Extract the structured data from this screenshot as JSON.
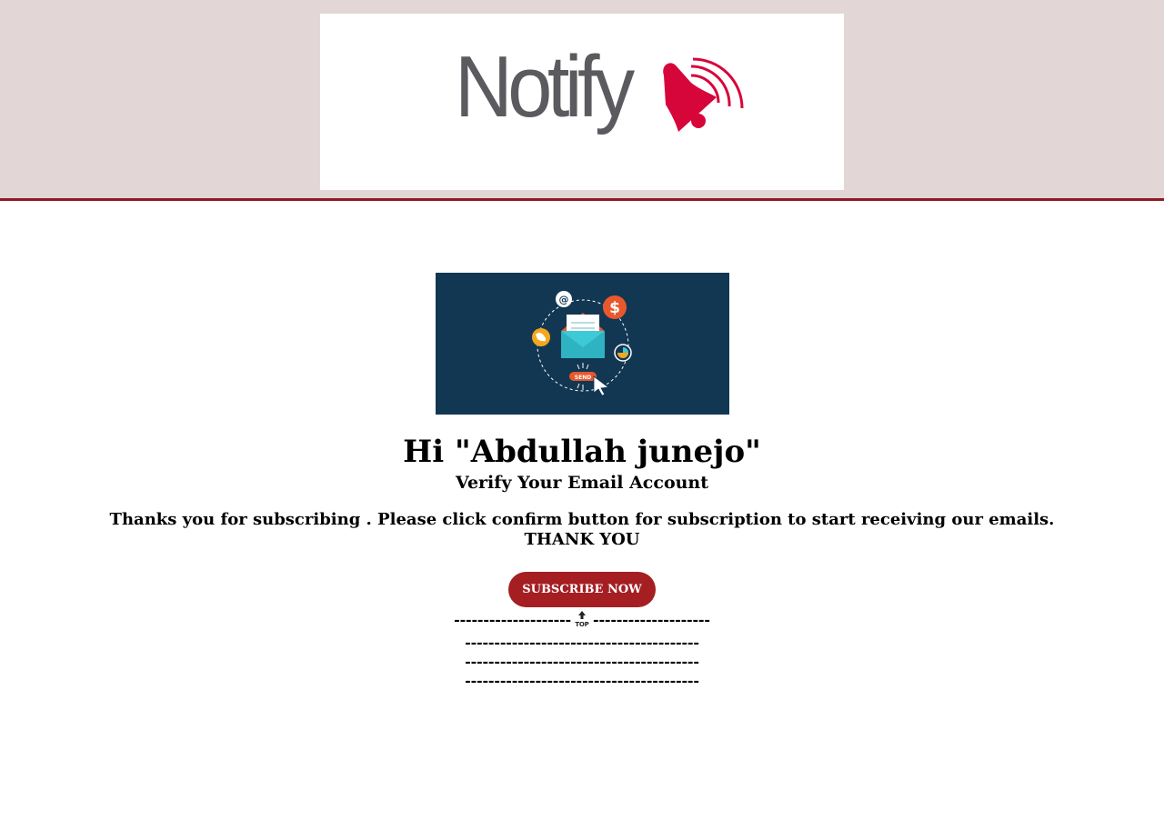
{
  "header": {
    "logo_text": "Notify",
    "colors": {
      "header_bg": "#e3d6d6",
      "header_border": "#8e1b25",
      "logo_text": "#5b5a5f",
      "logo_bell": "#d7063a"
    }
  },
  "hero": {
    "background": "#123753",
    "send_label": "SEND"
  },
  "content": {
    "greeting": "Hi \"Abdullah junejo\"",
    "subtitle": "Verify Your Email Account",
    "message": "Thanks you for subscribing . Please click confirm button for subscription to start receiving our emails.",
    "thanks": "THANK YOU"
  },
  "subscribe_button": {
    "label": "SUBSCRIBE NOW",
    "color": "#a41e22"
  },
  "footer": {
    "divider_left": "--------------------",
    "divider_right": "--------------------",
    "top_icon_label": "TOP",
    "divider_lines": [
      "----------------------------------------",
      "----------------------------------------",
      "----------------------------------------"
    ]
  }
}
